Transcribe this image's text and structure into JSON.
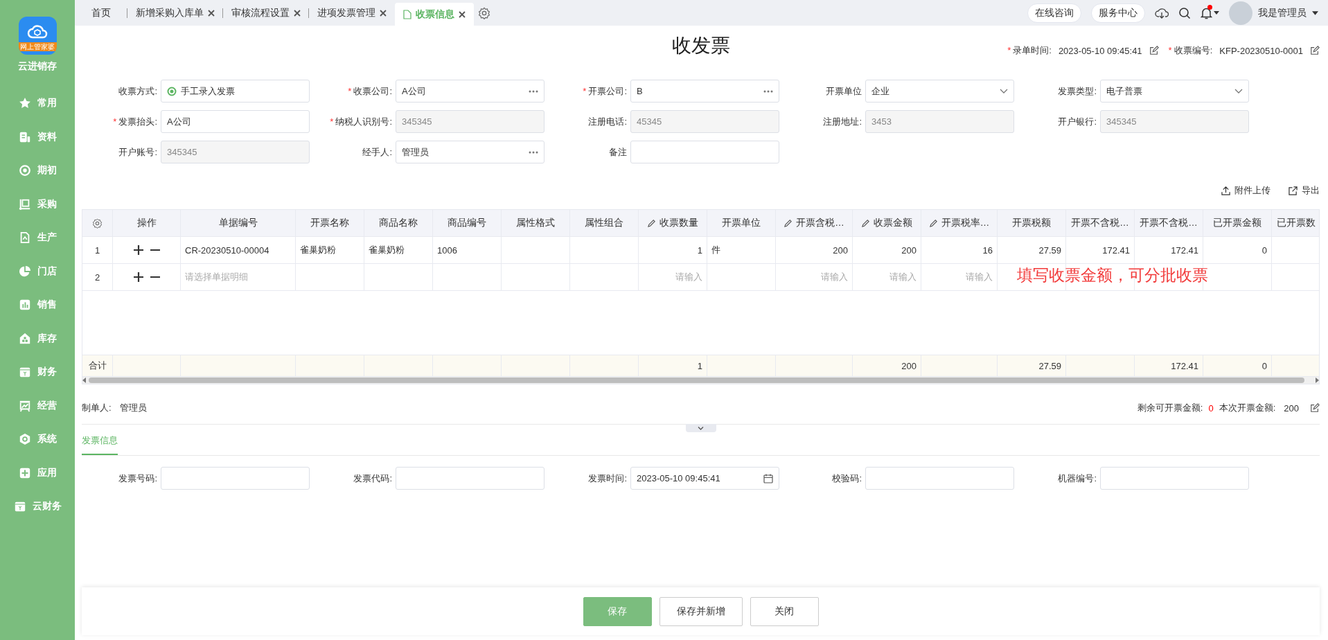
{
  "sidebar": {
    "logo_badge": "网上管家婆",
    "app_name": "云进销存",
    "items": [
      {
        "label": "常用"
      },
      {
        "label": "资料"
      },
      {
        "label": "期初"
      },
      {
        "label": "采购"
      },
      {
        "label": "生产"
      },
      {
        "label": "门店"
      },
      {
        "label": "销售"
      },
      {
        "label": "库存"
      },
      {
        "label": "财务"
      },
      {
        "label": "经营"
      },
      {
        "label": "系统"
      },
      {
        "label": "应用"
      },
      {
        "label": "云财务"
      }
    ]
  },
  "tabs": [
    {
      "label": "首页",
      "closable": false,
      "selected": false
    },
    {
      "label": "新增采购入库单",
      "closable": true,
      "selected": false
    },
    {
      "label": "审核流程设置",
      "closable": true,
      "selected": false
    },
    {
      "label": "进项发票管理",
      "closable": true,
      "selected": false
    },
    {
      "label": "收票信息",
      "closable": true,
      "selected": true
    }
  ],
  "header_buttons": [
    "在线咨询",
    "服务中心"
  ],
  "notifications": {
    "unread": true
  },
  "user": {
    "name": "我是管理员"
  },
  "page_title": "收发票",
  "meta": [
    {
      "mark": "*",
      "label": "录单时间:",
      "value": "2023-05-10 09:45:41"
    },
    {
      "mark": "*",
      "label": "收票编号:",
      "value": "KFP-20230510-0001"
    }
  ],
  "form": {
    "fields": [
      {
        "label": "收票方式:",
        "kind": "radio",
        "value": "手工录入发票"
      },
      {
        "mark": "*",
        "label": "收票公司:",
        "kind": "picker",
        "value": "A公司"
      },
      {
        "mark": "*",
        "label": "开票公司:",
        "kind": "picker",
        "value": "B"
      },
      {
        "label": "开票单位",
        "kind": "select",
        "value": "企业"
      },
      {
        "label": "发票类型:",
        "kind": "select",
        "value": "电子普票"
      },
      {
        "mark": "*",
        "label": "发票抬头:",
        "kind": "text",
        "value": "A公司"
      },
      {
        "mark": "*",
        "label": "纳税人识别号:",
        "kind": "readonly",
        "value": "345345"
      },
      {
        "label": "注册电话:",
        "kind": "readonly",
        "value": "45345"
      },
      {
        "label": "注册地址:",
        "kind": "readonly",
        "value": "3453"
      },
      {
        "label": "开户银行:",
        "kind": "readonly",
        "value": "345345"
      },
      {
        "label": "开户账号:",
        "kind": "readonly",
        "value": "345345"
      },
      {
        "label": "经手人:",
        "kind": "picker",
        "value": "管理员"
      },
      {
        "label": "备注",
        "kind": "text"
      }
    ]
  },
  "toolbar": [
    "附件上传",
    "导出"
  ],
  "table": {
    "columns": [
      {
        "label": "操作",
        "kind": "ops",
        "editable": false
      },
      {
        "label": "单据编号",
        "kind": "text",
        "editable": false
      },
      {
        "label": "开票名称",
        "kind": "text",
        "editable": false
      },
      {
        "label": "商品名称",
        "kind": "text",
        "editable": false
      },
      {
        "label": "商品编号",
        "kind": "text",
        "editable": false
      },
      {
        "label": "属性格式",
        "kind": "text",
        "editable": false
      },
      {
        "label": "属性组合",
        "kind": "text",
        "editable": false
      },
      {
        "label": "收票数量",
        "kind": "number",
        "editable": true
      },
      {
        "label": "开票单位",
        "kind": "text",
        "editable": false
      },
      {
        "label": "开票含税…",
        "kind": "number",
        "editable": true
      },
      {
        "label": "收票金额",
        "kind": "number",
        "editable": true
      },
      {
        "label": "开票税率…",
        "kind": "number",
        "editable": true
      },
      {
        "label": "开票税额",
        "kind": "number",
        "editable": false
      },
      {
        "label": "开票不含税…",
        "kind": "number",
        "editable": false
      },
      {
        "label": "开票不含税…",
        "kind": "number",
        "editable": false
      },
      {
        "label": "已开票金额",
        "kind": "number",
        "editable": false
      },
      {
        "label": "已开票数",
        "kind": "number",
        "editable": false
      }
    ],
    "rows": [
      {
        "index": "1",
        "cells": [
          null,
          "CR-20230510-00004",
          "雀巢奶粉",
          "雀巢奶粉",
          "1006",
          null,
          null,
          "1",
          "件",
          "200",
          "200",
          "16",
          "27.59",
          "172.41",
          "172.41",
          "0",
          null
        ]
      },
      {
        "index": "2",
        "cells": [
          null,
          {
            "placeholder": "请选择单据明细"
          },
          null,
          null,
          null,
          null,
          null,
          {
            "placeholder": "请输入"
          },
          null,
          {
            "placeholder": "请输入"
          },
          {
            "placeholder": "请输入"
          },
          {
            "placeholder": "请输入"
          },
          null,
          null,
          null,
          null,
          null
        ]
      }
    ],
    "total": {
      "label": "合计",
      "cells": [
        null,
        null,
        null,
        null,
        null,
        null,
        null,
        "1",
        null,
        null,
        "200",
        null,
        "27.59",
        null,
        "172.41",
        "0",
        null
      ]
    }
  },
  "annotation": "填写收票金额，可分批收票",
  "summary": {
    "creator_label": "制单人:",
    "creator": "管理员",
    "remaining_label": "剩余可开票金额:",
    "remaining": "0",
    "current_label": "本次开票金额:",
    "current": "200"
  },
  "invoice_tabs": [
    {
      "label": "发票信息",
      "selected": true
    }
  ],
  "invoice_fields": [
    {
      "label": "发票号码:",
      "kind": "text"
    },
    {
      "label": "发票代码:",
      "kind": "text"
    },
    {
      "label": "发票时间:",
      "kind": "date",
      "value": "2023-05-10 09:45:41"
    },
    {
      "label": "校验码:",
      "kind": "text"
    },
    {
      "label": "机器编号:",
      "kind": "text"
    }
  ],
  "actions": [
    {
      "label": "保存",
      "primary": true
    },
    {
      "label": "保存并新增",
      "primary": false
    },
    {
      "label": "关闭",
      "primary": false
    }
  ]
}
